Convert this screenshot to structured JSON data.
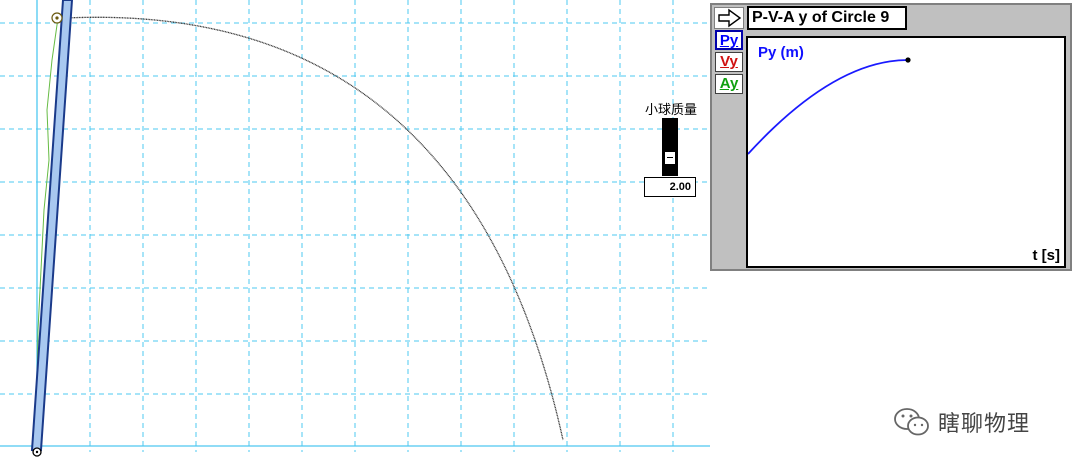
{
  "slider": {
    "label": "小球质量",
    "value": "2.00",
    "level": 0.25
  },
  "graph": {
    "title": "P-V-A y of Circle 9",
    "buttons": {
      "py": "Py",
      "vy": "Vy",
      "ay": "Ay"
    },
    "y_label": "Py (m)",
    "x_label": "t [s]",
    "line_color": "#1a1aff"
  },
  "colors": {
    "grid": "#4ec8f0",
    "rod_fill": "#a8c8f0",
    "rod_stroke": "#1a3a8a",
    "trajectory": "#333333",
    "trace": "#66bb44"
  },
  "watermark": {
    "text": "瞎聊物理",
    "icon": "wechat-icon"
  }
}
